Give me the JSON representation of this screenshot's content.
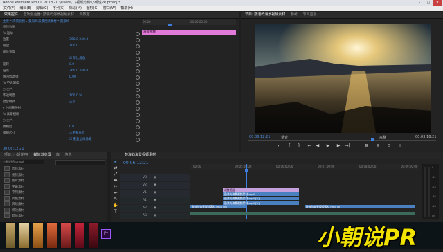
{
  "app": {
    "title": "Adobe Premiere Pro CC 2018 - C:\\Users\\...\\视频剪辑\\小朝说PR.prproj *",
    "window_controls": [
      "–",
      "□",
      "✕"
    ]
  },
  "menu": [
    "文件(F)",
    "编辑(E)",
    "剪辑(C)",
    "序列(S)",
    "标记(M)",
    "图形(G)",
    "窗口(W)",
    "帮助(H)"
  ],
  "top_tabs": {
    "left": [
      "效果控件",
      "音轨混合器: 鼓浪屿海景视频素材",
      "元数据"
    ],
    "right": [
      "节目: 鼓浪屿海景视频素材",
      "参考",
      "节目监视"
    ]
  },
  "effect_controls": {
    "header": "主要 * 海景视频 ▸ 鼓浪屿海景视频素材 * 鼓浪屿",
    "section": "视频效果",
    "clip_label": "海景视频",
    "ruler_start": "00:00",
    "ruler_mid": "00:00:05:00",
    "rows": [
      {
        "label": "fx  运动",
        "value": ""
      },
      {
        "label": "   位置",
        "value": "360.0   240.0"
      },
      {
        "label": "   缩放",
        "value": "100.0"
      },
      {
        "label": "   缩放宽度",
        "value": ""
      },
      {
        "label": "",
        "value": "☑ 等比缩放"
      },
      {
        "label": "   旋转",
        "value": "0.0"
      },
      {
        "label": "   锚点",
        "value": "360.0   240.0"
      },
      {
        "label": "   防闪烁滤镜",
        "value": "0.00"
      },
      {
        "label": "fx  不透明度",
        "value": ""
      },
      {
        "label": "   ○ □ ✎",
        "value": ""
      },
      {
        "label": "   不透明度",
        "value": "100.0 %"
      },
      {
        "label": "   混合模式",
        "value": "正常"
      },
      {
        "label": "▸ 时间重映射",
        "value": ""
      },
      {
        "label": "fx  高斯模糊",
        "value": ""
      },
      {
        "label": "   ○ □ ✎",
        "value": ""
      },
      {
        "label": "   模糊度",
        "value": "0.0"
      },
      {
        "label": "   模糊尺寸",
        "value": "水平和垂直"
      },
      {
        "label": "",
        "value": "☐ 重复边缘像素"
      }
    ],
    "timecode": "00:06:12:21"
  },
  "program": {
    "timecode_left": "00:06:12:21",
    "fit": "适合",
    "quality": "完整",
    "timecode_right": "00:03:18:21",
    "transport": [
      "▾",
      "{",
      "}",
      "|←",
      "◀|",
      "▶",
      "|▶",
      "→|",
      "⊞",
      "⊟",
      "⊡",
      "+"
    ]
  },
  "project": {
    "tabs": [
      "项目: 小朝说PR",
      "媒体浏览器",
      "库",
      "信息"
    ],
    "path": "小朝说PR.prproj",
    "items": [
      "音频素材",
      "视频素材",
      "图片素材",
      "字幕素材",
      "序列素材",
      "调色素材",
      "转场素材",
      "特效素材",
      "其他素材"
    ]
  },
  "timeline": {
    "tab": "鼓浪屿海景视频素材",
    "timecode": "00:06:12:21",
    "ruler": [
      "00:00",
      "00:05:00:00",
      "00:06:00:00",
      "00:07:00:00",
      "00:08:00:00",
      "00:09:00:00"
    ],
    "tracks": [
      "V3",
      "V2",
      "V1",
      "A1",
      "A2",
      "A3"
    ],
    "clips": [
      {
        "label": "调整图层",
        "color": "#c6a0dc"
      },
      {
        "label": "鼓浪屿海景视频素材.mp4",
        "color": "#4a7fc0"
      },
      {
        "label": "鼓浪屿海景视频素材.mp4 [V]",
        "color": "#4a7fc0"
      },
      {
        "label": "鼓浪屿海景视频素材.mp4 [V]",
        "color": "#4a7fc0"
      },
      {
        "label": "鼓浪屿海景视频素材.mp4 [V]",
        "color": "#4a7fc0"
      },
      {
        "label": "鼓浪屿海景视频素材.mp4 [V]",
        "color": "#4a7fc0"
      }
    ],
    "audio_meter_labels": [
      "0",
      "-12",
      "-24",
      "-36",
      "-48",
      "dB"
    ]
  },
  "tools": [
    "▸",
    "⇄",
    "⤢",
    "⬌",
    "✂",
    "⇤",
    "✎",
    "✋",
    "T"
  ],
  "watermark": "小朝说PR"
}
